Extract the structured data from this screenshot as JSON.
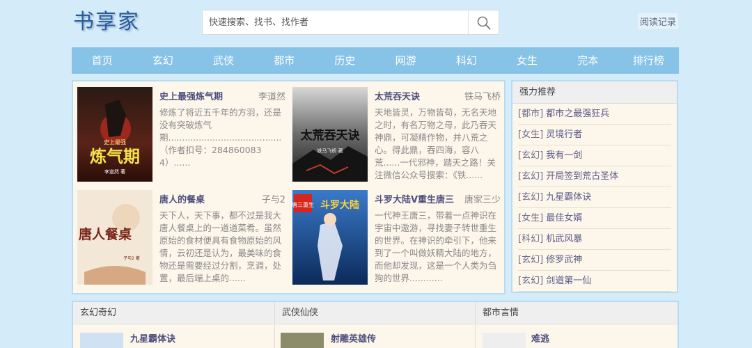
{
  "site": {
    "logo": "书享家",
    "history_label": "阅读记录"
  },
  "search": {
    "placeholder": "快速搜索、找书、找作者"
  },
  "nav": {
    "items": [
      "首页",
      "玄幻",
      "武侠",
      "都市",
      "历史",
      "网游",
      "科幻",
      "女生",
      "完本",
      "排行榜"
    ]
  },
  "featured": [
    {
      "title": "史上最强炼气期",
      "author": "李道然",
      "desc": "修炼了将近五千年的方羽，还是没有突破炼气期.........................................（作者扣号：2848600834）......",
      "cover_text": "炼气期",
      "cover_small": "史上最强",
      "cover_author": "李道然 著"
    },
    {
      "title": "太荒吞天诀",
      "author": "铁马飞桥",
      "desc": "天地皆灵，万物皆苟，无名天地之时，有名万物之母，此乃吞天神鼎，可凝精作物，并八荒之心。得此鼎，吞四海，容八荒......一代邪神，踏天之路！关注微信公众号搜索：《铁......",
      "cover_text": "太荒吞天诀",
      "cover_small": "铁马飞桥 著"
    },
    {
      "title": "唐人的餐桌",
      "author": "子与2",
      "desc": "天下人，天下事，都不过是我大唐人餐桌上的一道道菜肴。虽然原始的食材便具有食物原始的风情，云初还是认为，最美味的食物还是需要经过分割，烹调，处置，最后端上桌的......",
      "cover_text": "唐人餐桌",
      "cover_small": "子与2 著"
    },
    {
      "title": "斗罗大陆V重生唐三",
      "author": "唐家三少",
      "desc": "一代神王唐三，带着一点神识在宇宙中遨游，寻找妻子转世重生的世界。在神识的牵引下，他来到了一个叫做妖精大陆的地方，而他却发现，这是一个人类为刍狗的世界............",
      "cover_text": "斗罗大陆",
      "cover_small": "唐三重生"
    }
  ],
  "recommend": {
    "title": "强力推荐",
    "items": [
      {
        "cat": "[都市]",
        "name": "都市之最强狂兵"
      },
      {
        "cat": "[女生]",
        "name": "灵境行者"
      },
      {
        "cat": "[玄幻]",
        "name": "我有一剑"
      },
      {
        "cat": "[玄幻]",
        "name": "开局签到荒古圣体"
      },
      {
        "cat": "[玄幻]",
        "name": "九星霸体诀"
      },
      {
        "cat": "[女生]",
        "name": "最佳女婿"
      },
      {
        "cat": "[科幻]",
        "name": "机武风暴"
      },
      {
        "cat": "[玄幻]",
        "name": "修罗武神"
      },
      {
        "cat": "[玄幻]",
        "name": "剑道第一仙"
      }
    ]
  },
  "categories": [
    {
      "title": "玄幻奇幻",
      "first_book": "九星霸体诀"
    },
    {
      "title": "武侠仙侠",
      "first_book": "射雕英雄传"
    },
    {
      "title": "都市言情",
      "first_book": "难逃"
    }
  ],
  "colors": {
    "nav_bg": "#87c2e7",
    "page_bg": "#d4ebfa",
    "panel_bg": "#fcf6eb",
    "title": "#4f4f7e"
  }
}
